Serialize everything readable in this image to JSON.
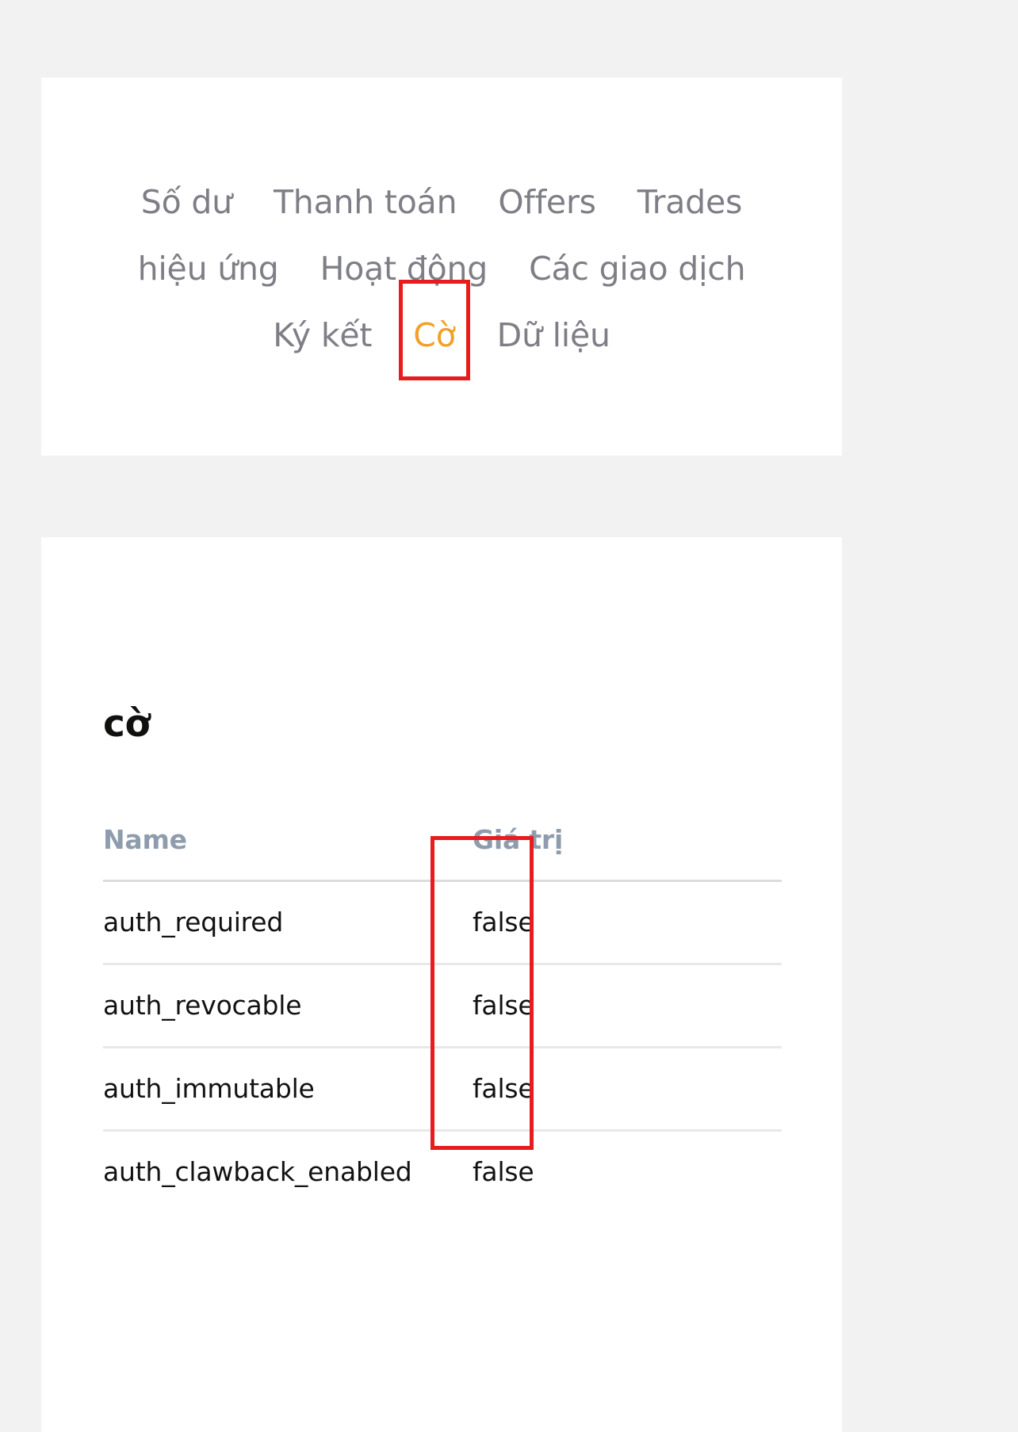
{
  "theme": {
    "page_background": "#f2f2f2",
    "card_background": "#ffffff",
    "tab_color": "#7e7e86",
    "tab_active_color": "#f2a024",
    "annotation_color": "#e81c1c",
    "table_header_color": "#8f9cad",
    "table_text_color": "#121212"
  },
  "nav": {
    "rows": [
      [
        {
          "label": "Số dư",
          "active": false,
          "annotated": false
        },
        {
          "label": "Thanh toán",
          "active": false,
          "annotated": false
        },
        {
          "label": "Offers",
          "active": false,
          "annotated": false
        },
        {
          "label": "Trades",
          "active": false,
          "annotated": false
        }
      ],
      [
        {
          "label": "hiệu ứng",
          "active": false,
          "annotated": false
        },
        {
          "label": "Hoạt động",
          "active": false,
          "annotated": false
        },
        {
          "label": "Các giao dịch",
          "active": false,
          "annotated": false
        }
      ],
      [
        {
          "label": "Ký kết",
          "active": false,
          "annotated": false
        },
        {
          "label": "Cờ",
          "active": true,
          "annotated": true
        },
        {
          "label": "Dữ liệu",
          "active": false,
          "annotated": false
        }
      ]
    ]
  },
  "flags_panel": {
    "title": "cờ",
    "columns": {
      "name": "Name",
      "value": "Giá trị"
    },
    "rows": [
      {
        "name": "auth_required",
        "value": "false"
      },
      {
        "name": "auth_revocable",
        "value": "false"
      },
      {
        "name": "auth_immutable",
        "value": "false"
      },
      {
        "name": "auth_clawback_enabled",
        "value": "false"
      }
    ]
  }
}
